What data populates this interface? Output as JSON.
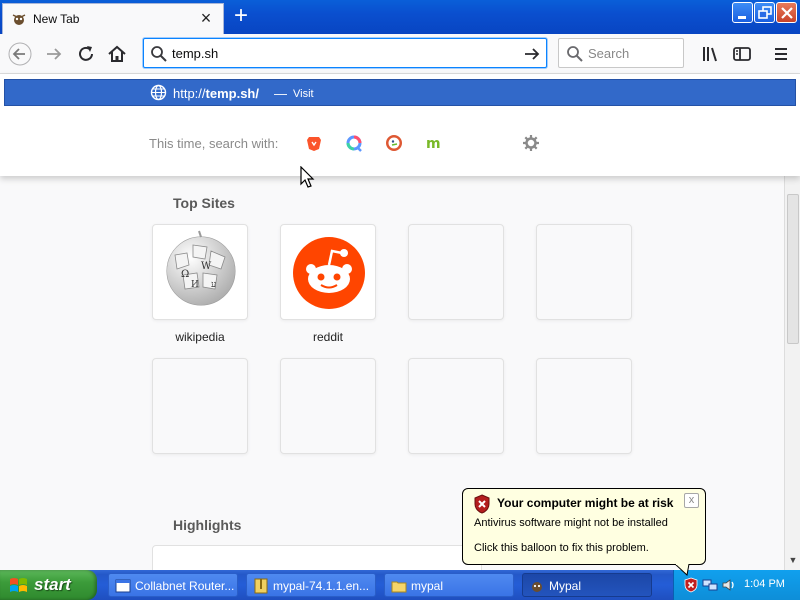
{
  "window": {
    "tab_title": "New Tab",
    "new_tab_symbol": "+",
    "tab_close_symbol": "×"
  },
  "toolbar": {
    "url_value": "temp.sh",
    "search_placeholder": "Search"
  },
  "urlbar_dropdown": {
    "suggestion_url_prefix": "http://",
    "suggestion_url_host": "temp.sh/",
    "suggestion_separator": "—",
    "suggestion_action": "Visit",
    "oneoff_label": "This time, search with:",
    "engines": [
      "brave-icon",
      "qwant-icon",
      "duckduckgo-icon",
      "mojeek-icon"
    ]
  },
  "top_sites": {
    "title": "Top Sites",
    "tiles": [
      {
        "label": "wikipedia",
        "icon": "wikipedia-globe-icon"
      },
      {
        "label": "reddit",
        "icon": "reddit-icon"
      }
    ]
  },
  "highlights": {
    "title": "Highlights"
  },
  "balloon": {
    "title": "Your computer might be at risk",
    "line1": "Antivirus software might not be installed",
    "line2": "Click this balloon to fix this problem.",
    "close_symbol": "x"
  },
  "taskbar": {
    "start_label": "start",
    "buttons": [
      {
        "label": "Collabnet Router..."
      },
      {
        "label": "mypal-74.1.1.en..."
      },
      {
        "label": "mypal"
      },
      {
        "label": "Mypal"
      }
    ],
    "clock": "1:04 PM"
  },
  "colors": {
    "xp_blue": "#0a4fcf",
    "suggestion_highlight": "#3269c9",
    "urlbar_focus": "#0a84ff",
    "reddit_orange": "#ff4500",
    "balloon_bg": "#ffffe1",
    "start_green": "#3c9c3a"
  }
}
